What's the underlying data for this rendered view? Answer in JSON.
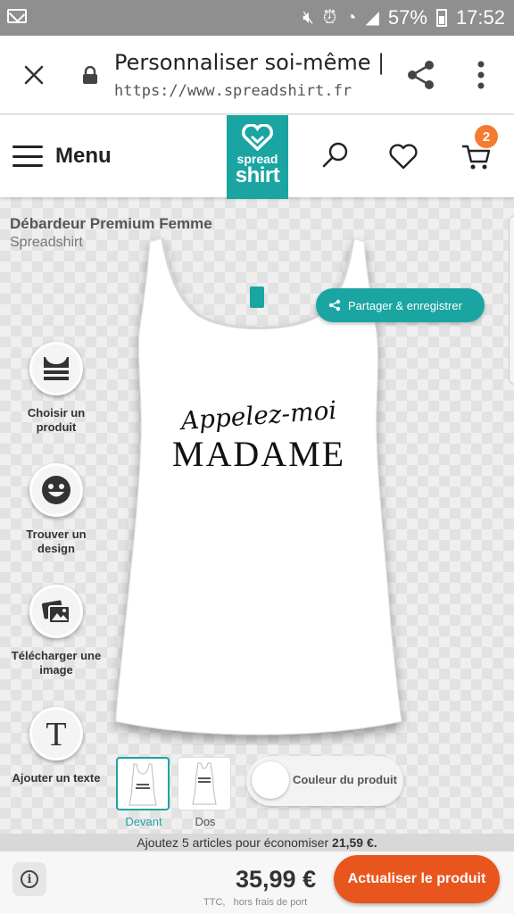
{
  "status_bar": {
    "battery": "57%",
    "time": "17:52"
  },
  "browser": {
    "title": "Personnaliser soi-même | ...",
    "url": "https://www.spreadshirt.fr"
  },
  "header": {
    "menu_label": "Menu",
    "logo_line1": "spread",
    "logo_line2": "shirt",
    "cart_count": "2"
  },
  "product": {
    "name": "Débardeur Premium Femme",
    "brand": "Spreadshirt",
    "design_line1": "Appelez-moi",
    "design_line2": "MADAME"
  },
  "share_label": "Partager & enregistrer",
  "tools": [
    {
      "label": "Choisir un produit",
      "icon": "tank-top-icon"
    },
    {
      "label": "Trouver un design",
      "icon": "smiley-icon"
    },
    {
      "label": "Télécharger une image",
      "icon": "images-icon"
    },
    {
      "label": "Ajouter un texte",
      "icon": "text-t-icon"
    }
  ],
  "views": [
    {
      "label": "Devant",
      "active": true
    },
    {
      "label": "Dos",
      "active": false
    }
  ],
  "color_label": "Couleur du produit",
  "savings": {
    "text": "Ajoutez 5 articles pour économiser ",
    "amount": "21,59 €."
  },
  "footer": {
    "price": "35,99 €",
    "note_ttc": "TTC,",
    "note_shipping": "hors frais de port",
    "update_label": "Actualiser le produit"
  },
  "colors": {
    "brand_teal": "#1aa5a2",
    "cta_orange": "#e8561e",
    "badge_orange": "#f47b30"
  }
}
